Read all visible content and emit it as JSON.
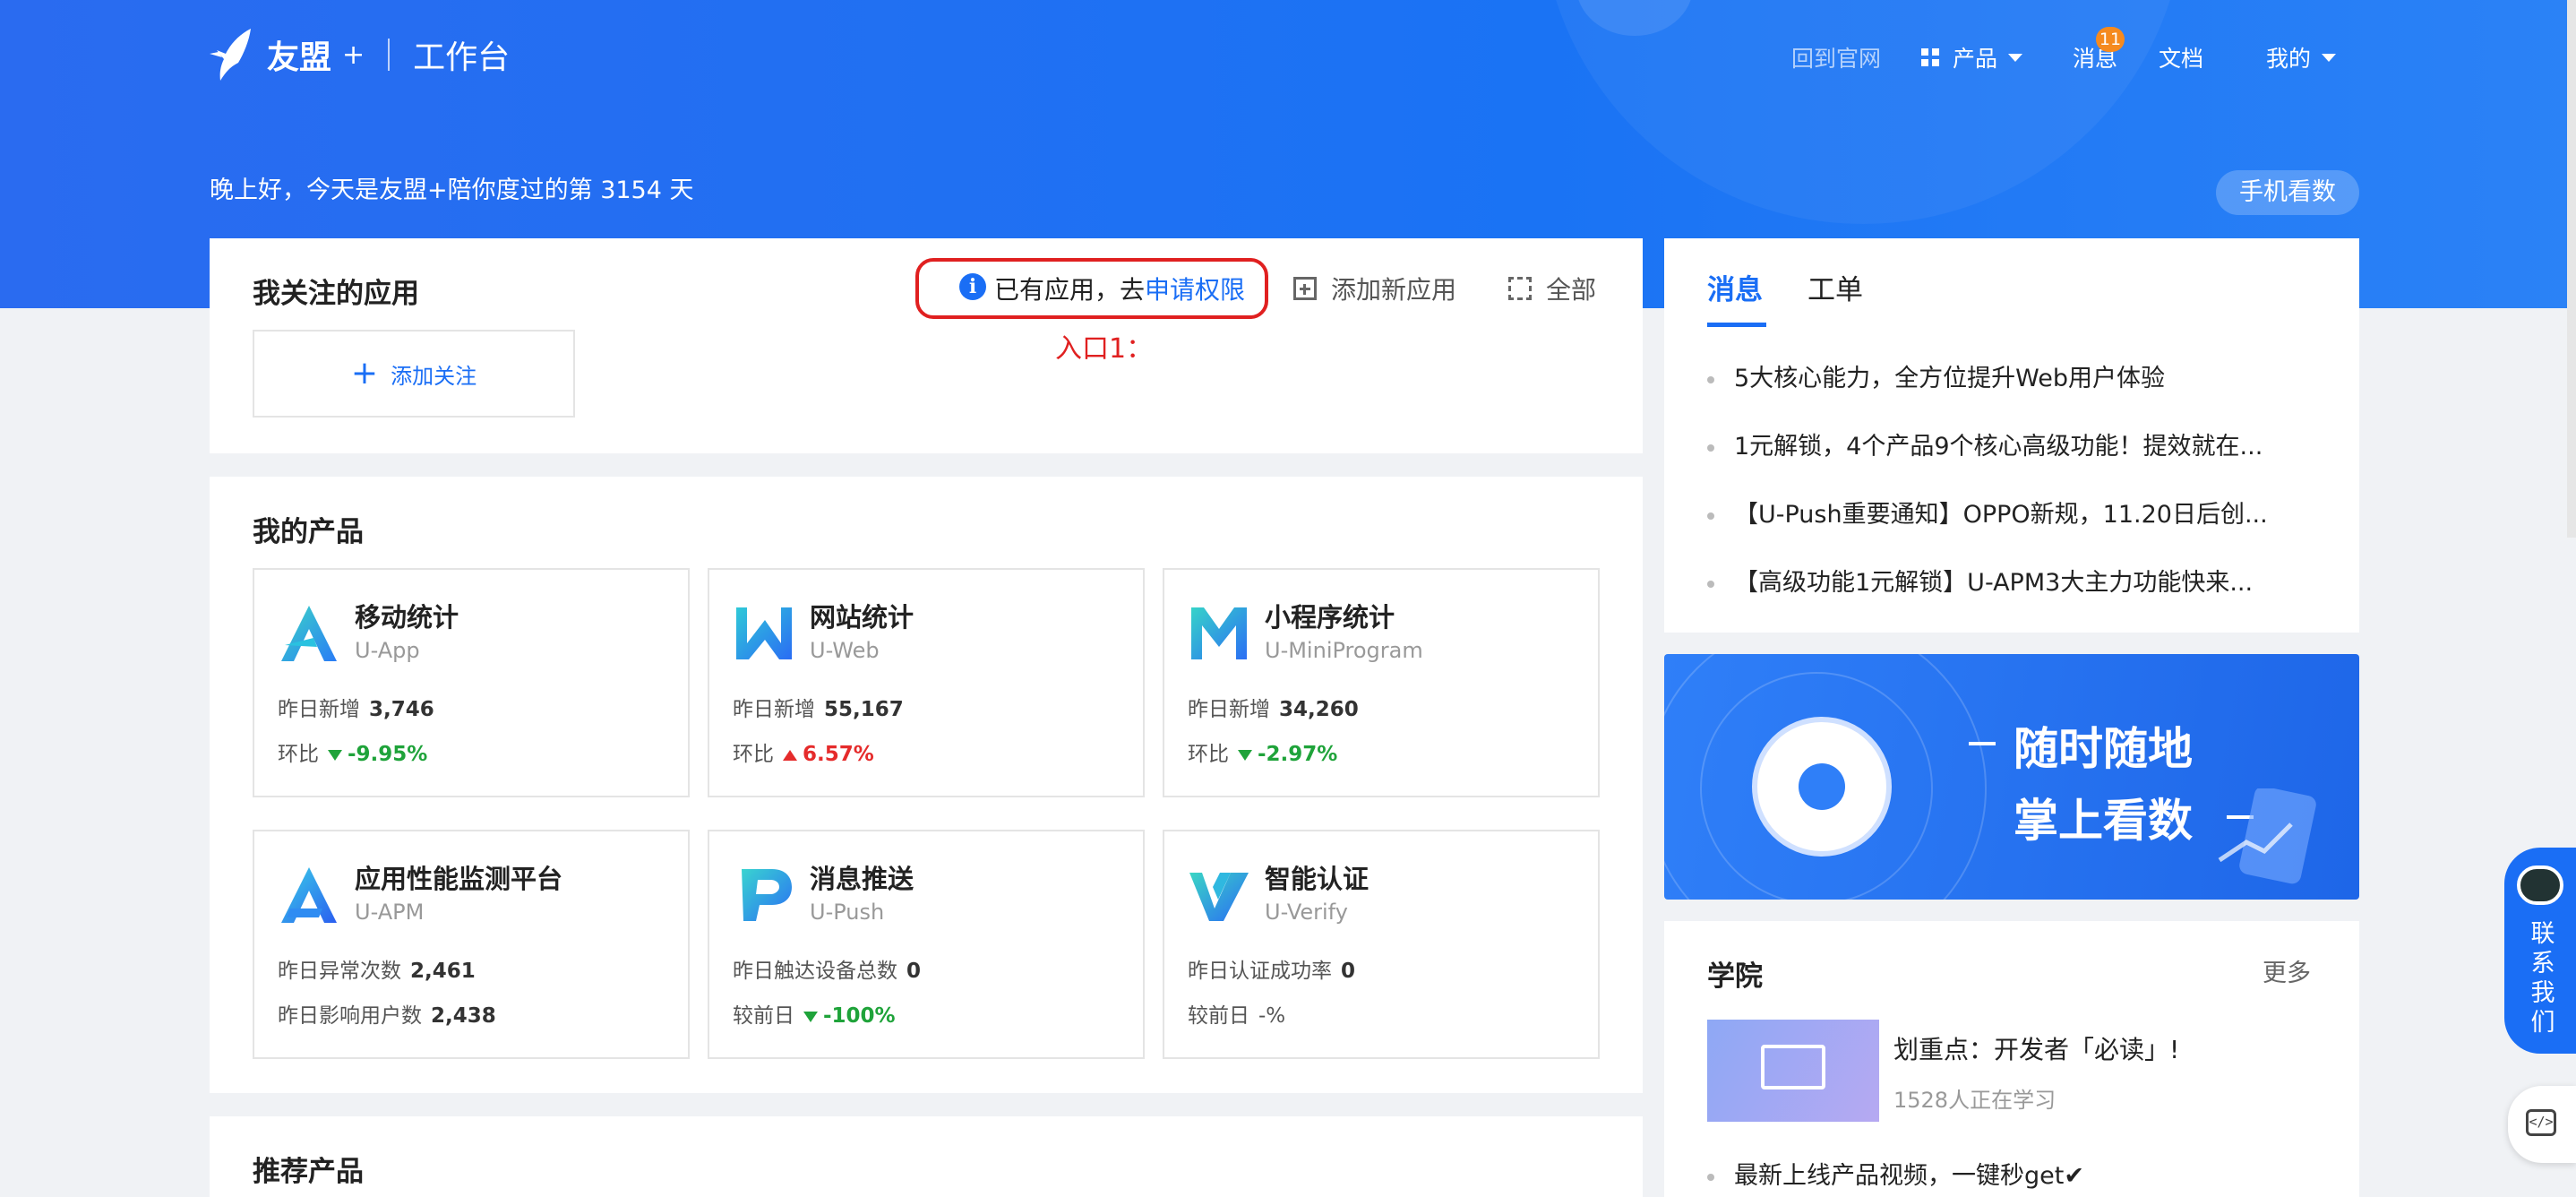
{
  "header": {
    "brand": "友盟",
    "plus": "+",
    "workspace": "工作台",
    "nav": {
      "official_site": "回到官网",
      "products": "产品",
      "messages": "消息",
      "messages_badge": "11",
      "docs": "文档",
      "mine": "我的"
    },
    "greeting": "晚上好，今天是友盟+陪你度过的第 3154 天",
    "mobile_button": "手机看数"
  },
  "followed_apps": {
    "title": "我关注的应用",
    "notice_prefix": "已有应用，去",
    "notice_link": "申请权限",
    "annotation": "入口1：",
    "add_new_app": "添加新应用",
    "all": "全部",
    "add_follow": "添加关注"
  },
  "my_products": {
    "title": "我的产品",
    "items": [
      {
        "name": "移动统计",
        "sub": "U-App",
        "row1_label": "昨日新增",
        "row1_value": "3,746",
        "row2_label": "环比",
        "row2_value": "-9.95%",
        "trend": "down"
      },
      {
        "name": "网站统计",
        "sub": "U-Web",
        "row1_label": "昨日新增",
        "row1_value": "55,167",
        "row2_label": "环比",
        "row2_value": "6.57%",
        "trend": "up"
      },
      {
        "name": "小程序统计",
        "sub": "U-MiniProgram",
        "row1_label": "昨日新增",
        "row1_value": "34,260",
        "row2_label": "环比",
        "row2_value": "-2.97%",
        "trend": "down"
      },
      {
        "name": "应用性能监测平台",
        "sub": "U-APM",
        "row1_label": "昨日异常次数",
        "row1_value": "2,461",
        "row2_label": "昨日影响用户数",
        "row2_value": "2,438",
        "trend": "none"
      },
      {
        "name": "消息推送",
        "sub": "U-Push",
        "row1_label": "昨日触达设备总数",
        "row1_value": "0",
        "row2_label": "较前日",
        "row2_value": "-100%",
        "trend": "down"
      },
      {
        "name": "智能认证",
        "sub": "U-Verify",
        "row1_label": "昨日认证成功率",
        "row1_value": "0",
        "row2_label": "较前日",
        "row2_value": "-%",
        "trend": "none"
      }
    ]
  },
  "recommended": {
    "title": "推荐产品"
  },
  "news_panel": {
    "tabs": [
      "消息",
      "工单"
    ],
    "items": [
      "5大核心能力，全方位提升Web用户体验",
      "1元解锁，4个产品9个核心高级功能！提效就在...",
      "【U-Push重要通知】OPPO新规，11.20日后创...",
      "【高级功能1元解锁】U-APM3大主力功能快来..."
    ]
  },
  "banner": {
    "line1": "随时随地",
    "line2": "掌上看数"
  },
  "academy": {
    "title": "学院",
    "more": "更多",
    "course_title": "划重点：开发者「必读」!",
    "course_learners": "1528人正在学习",
    "list_item": "最新上线产品视频，一键秒get✔"
  },
  "contact": {
    "label": "联系我们"
  },
  "colors": {
    "primary": "#1a6ef5",
    "hero": "#2a6bf0",
    "down": "#1fa33a",
    "up": "#e52b2b",
    "alert": "#e02020"
  }
}
